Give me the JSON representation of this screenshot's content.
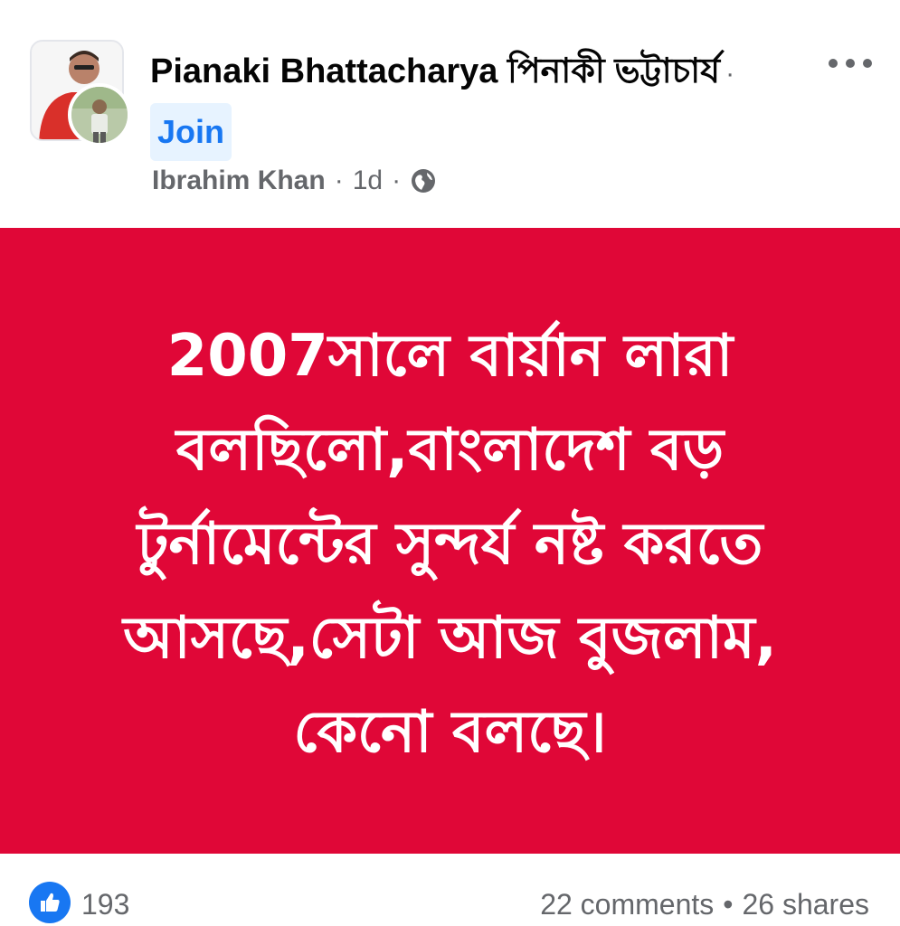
{
  "post": {
    "group_name": "Pianaki Bhattacharya পিনাকী ভট্টাচার্য",
    "separator": "·",
    "join_label": "Join",
    "author": "Ibrahim Khan",
    "time": "1d",
    "meta_separator": "·",
    "privacy_icon": "globe-icon",
    "more_icon": "more-options-icon",
    "text": "2007সালে বার্য়ান লারা বলছিলো,বাংলাদেশ বড় টুর্নামেন্টের সুন্দর্য নষ্ট করতে আসছে,সেটা আজ বুজলাম, কেনো বলছে।",
    "background_color": "#e00737"
  },
  "footer": {
    "reaction_icon": "like-icon",
    "like_count": "193",
    "comments": "22 comments",
    "bullet": "•",
    "shares": "26 shares"
  },
  "colors": {
    "accent": "#1877f2",
    "join_bg": "#e7f3ff",
    "secondary_text": "#65676b"
  }
}
